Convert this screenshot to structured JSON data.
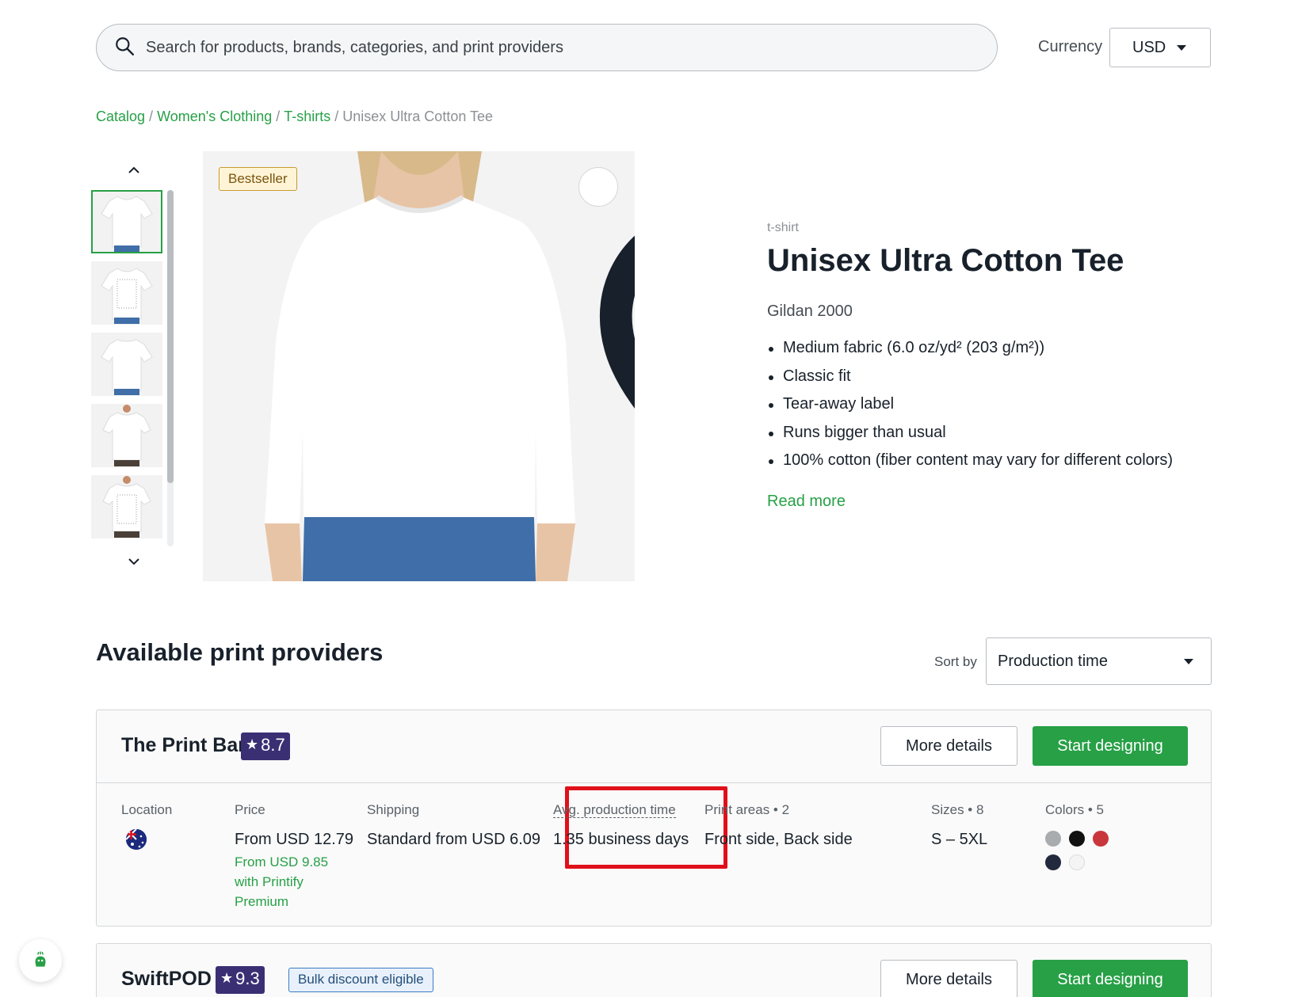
{
  "search": {
    "placeholder": "Search for products, brands, categories, and print providers"
  },
  "currency": {
    "label": "Currency",
    "value": "USD"
  },
  "breadcrumb": {
    "items": [
      "Catalog",
      "Women's Clothing",
      "T-shirts"
    ],
    "current": "Unisex Ultra Cotton Tee"
  },
  "gallery": {
    "badge": "Bestseller",
    "thumbnail_count": 5,
    "active_thumbnail": 1
  },
  "product": {
    "type": "t-shirt",
    "title": "Unisex Ultra Cotton Tee",
    "brand": "Gildan 2000",
    "features": [
      "Medium fabric (6.0 oz/yd² (203 g/m²))",
      "Classic fit",
      "Tear-away label",
      "Runs bigger than usual",
      "100% cotton (fiber content may vary for different colors)"
    ],
    "read_more": "Read more"
  },
  "providers": {
    "title": "Available print providers",
    "sort_label": "Sort by",
    "sort_value": "Production time",
    "list": [
      {
        "name": "The Print Bar",
        "rating": "8.7",
        "more_label": "More details",
        "start_label": "Start designing",
        "location_label": "Location",
        "price_label": "Price",
        "price": "From USD 12.79",
        "premium_price": "From USD 9.85 with Printify Premium",
        "shipping_label": "Shipping",
        "shipping": "Standard from USD 6.09",
        "production_label": "Avg. production time",
        "production": "1.35 business days",
        "print_areas_label": "Print areas • 2",
        "print_areas": "Front side, Back side",
        "sizes_label": "Sizes • 8",
        "sizes": "S – 5XL",
        "colors_label": "Colors • 5",
        "colors": [
          "#a9acaf",
          "#111111",
          "#c8373c",
          "#232a3d",
          "#f4f4f4"
        ]
      },
      {
        "name": "SwiftPOD",
        "rating": "9.3",
        "badge": "Bulk discount eligible",
        "more_label": "More details",
        "start_label": "Start designing"
      }
    ]
  },
  "colors": {
    "accent": "#27a046",
    "rating_bg": "#3a2f73",
    "highlight": "#e0101a"
  }
}
